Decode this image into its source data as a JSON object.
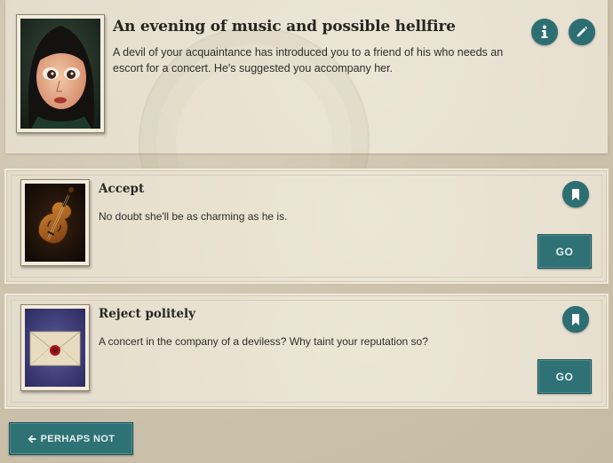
{
  "storylet": {
    "title": "An evening of music and possible hellfire",
    "description": "A devil of your acquaintance has introduced you to a friend of his who needs an escort for a concert. He's suggested you accompany her.",
    "info_icon": "info-icon",
    "edit_icon": "pencil-icon",
    "image": "portrait of pale woman with large dark eyes"
  },
  "branches": [
    {
      "title": "Accept",
      "description": "No doubt she'll be as charming as he is.",
      "button_label": "GO",
      "bookmark_icon": "bookmark-icon",
      "image": "violin"
    },
    {
      "title": "Reject politely",
      "description": "A concert in the company of a deviless? Why taint your reputation so?",
      "button_label": "GO",
      "bookmark_icon": "bookmark-icon",
      "image": "sealed envelope with red wax seal"
    }
  ],
  "footer": {
    "back_label": "PERHAPS NOT",
    "back_icon": "arrow-left-icon"
  },
  "colors": {
    "accent": "#2f7276",
    "background": "#cfc5b0",
    "panel": "#e9e2d2"
  }
}
